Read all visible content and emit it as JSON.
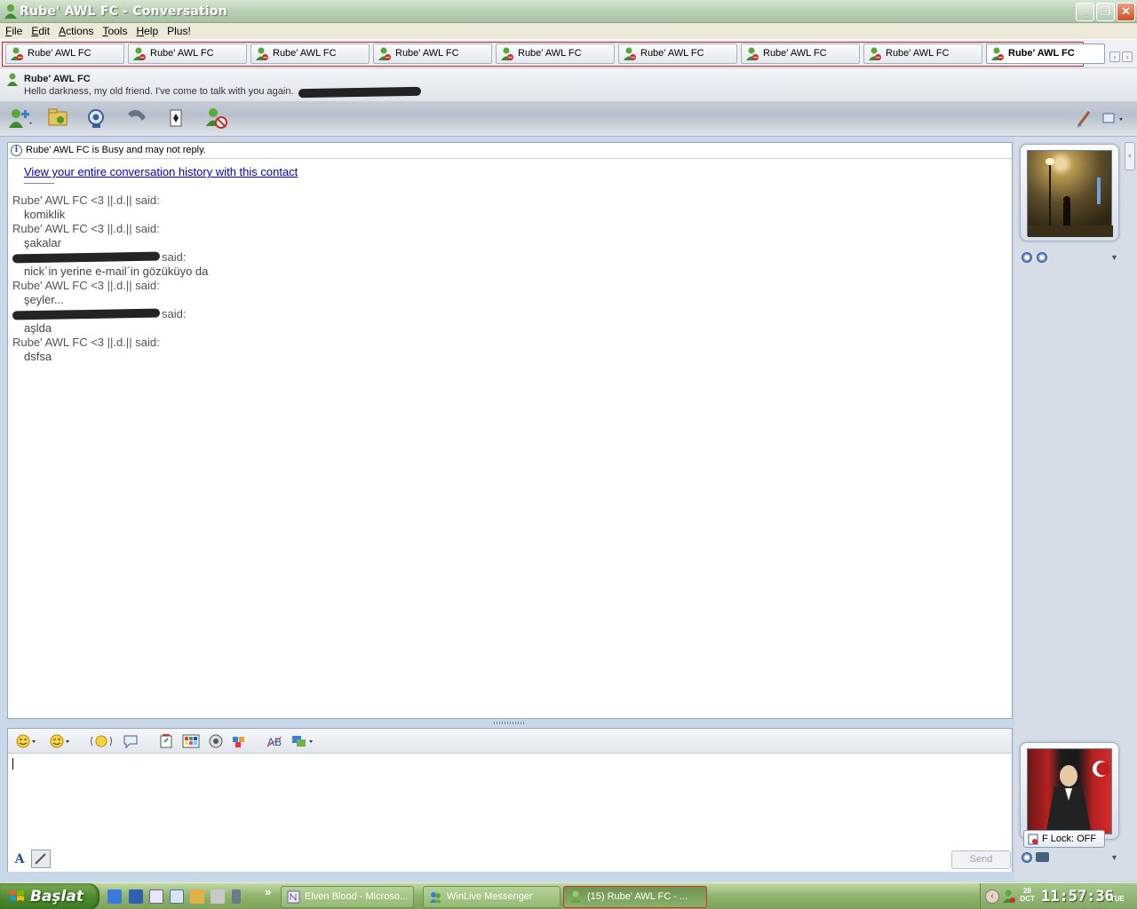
{
  "window": {
    "title": "Rube'  AWL FC - Conversation"
  },
  "menu": [
    {
      "label": "File",
      "accel": "F"
    },
    {
      "label": "Edit",
      "accel": "E"
    },
    {
      "label": "Actions",
      "accel": "A"
    },
    {
      "label": "Tools",
      "accel": "T"
    },
    {
      "label": "Help",
      "accel": "H"
    },
    {
      "label": "Plus!",
      "accel": ""
    }
  ],
  "tabs": [
    {
      "label": "Rube'  AWL FC",
      "active": false
    },
    {
      "label": "Rube'  AWL FC",
      "active": false
    },
    {
      "label": "Rube'  AWL FC",
      "active": false
    },
    {
      "label": "Rube'  AWL FC",
      "active": false
    },
    {
      "label": "Rube'  AWL FC",
      "active": false
    },
    {
      "label": "Rube'  AWL FC",
      "active": false
    },
    {
      "label": "Rube'  AWL FC",
      "active": false
    },
    {
      "label": "Rube'  AWL FC",
      "active": false
    },
    {
      "label": "Rube'  AWL FC",
      "active": true
    }
  ],
  "contact": {
    "name": "Rube'  AWL FC",
    "personal_message": "Hello darkness, my old friend. I've come to talk with you again."
  },
  "toolbar_icons": [
    "invite-contact-icon",
    "send-files-icon",
    "video-call-icon",
    "voice-call-icon",
    "games-icon",
    "block-contact-icon"
  ],
  "conversation": {
    "status_notice": "Rube'  AWL FC is Busy and may not reply.",
    "history_link": "View your entire conversation history with this contact",
    "messages": [
      {
        "sender": "Rube'  AWL FC <3 ||.d.|| said:",
        "redacted": false,
        "text": "komiklik"
      },
      {
        "sender": "Rube'  AWL FC <3 ||.d.|| said:",
        "redacted": false,
        "text": "şakalar"
      },
      {
        "sender": "said:",
        "redacted": true,
        "text": "nick´in yerine e-mail´in gözüküyo da"
      },
      {
        "sender": "Rube'  AWL FC <3 ||.d.|| said:",
        "redacted": false,
        "text": "şeyler..."
      },
      {
        "sender": "said:",
        "redacted": true,
        "text": "aşlda"
      },
      {
        "sender": "Rube'  AWL FC <3 ||.d.|| said:",
        "redacted": false,
        "text": "dsfsa"
      }
    ]
  },
  "input": {
    "value": "",
    "send_label": "Send"
  },
  "sidebar": {
    "flock_label": "F Lock: OFF"
  },
  "taskbar": {
    "start_label": "Başlat",
    "overflow_label": "»",
    "tasks": [
      {
        "label": "Elven Blood - Microso...",
        "active": false
      },
      {
        "label": "WinLive Messenger",
        "active": false
      },
      {
        "label": "(15) Rube'  AWL FC - ...",
        "active": true
      }
    ],
    "clock": "11:57:36",
    "date_day": "28",
    "date_month": "OCT",
    "weekday": "TUE"
  },
  "colors": {
    "link": "#0000cc",
    "highlight_frame": "#d02020",
    "title_bar": "#b9cfb5"
  }
}
